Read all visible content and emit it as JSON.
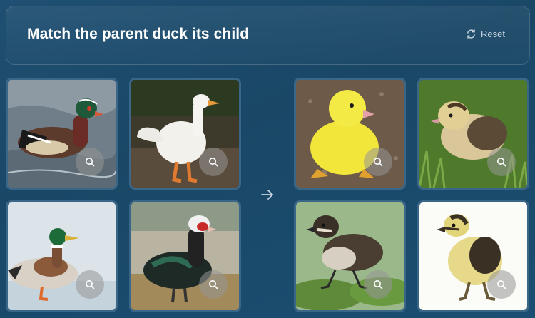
{
  "header": {
    "title": "Match the parent duck its child",
    "reset_label": "Reset"
  },
  "parents": [
    {
      "name": "wood duck",
      "icon": "wood-duck-photo"
    },
    {
      "name": "white pekin duck",
      "icon": "pekin-duck-photo"
    },
    {
      "name": "mallard duck",
      "icon": "mallard-duck-photo"
    },
    {
      "name": "muscovy duck",
      "icon": "muscovy-duck-photo"
    }
  ],
  "children": [
    {
      "name": "yellow duckling",
      "icon": "yellow-duckling-photo"
    },
    {
      "name": "fluffy duckling in grass",
      "icon": "grass-duckling-photo"
    },
    {
      "name": "dark duckling on lily pad",
      "icon": "lilypad-duckling-photo"
    },
    {
      "name": "striped duckling on white",
      "icon": "white-bg-duckling-photo"
    }
  ],
  "colors": {
    "background": "#1b4a6b",
    "tile_border": "#3a6688",
    "reset_text": "#c9d6e2"
  }
}
